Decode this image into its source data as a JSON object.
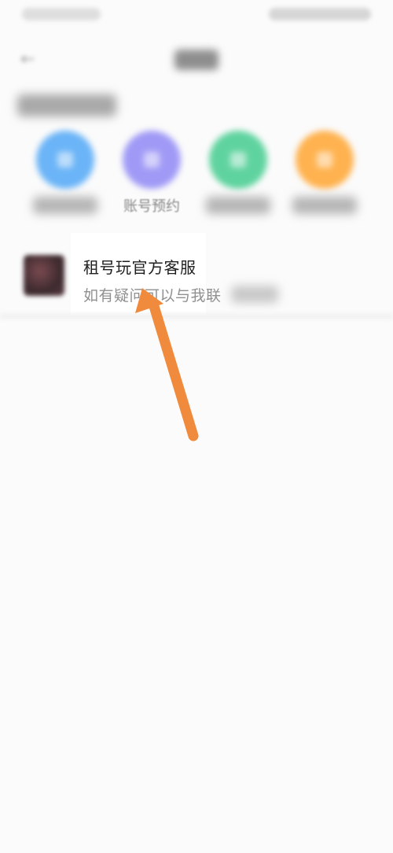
{
  "quick_entries": [
    {
      "label": "",
      "color": "#6ab4f7",
      "icon": "blurred-icon"
    },
    {
      "label": "账号预约",
      "color": "#a09af6",
      "icon": "blurred-icon"
    },
    {
      "label": "",
      "color": "#5fd39f",
      "icon": "blurred-icon"
    },
    {
      "label": "",
      "color": "#ffb24f",
      "icon": "blurred-icon"
    }
  ],
  "chat": {
    "name": "租号玩官方客服",
    "preview": "如有疑问可以与我联"
  },
  "colors": {
    "arrow": "#f08a3c",
    "background": "#fbfbfb"
  }
}
